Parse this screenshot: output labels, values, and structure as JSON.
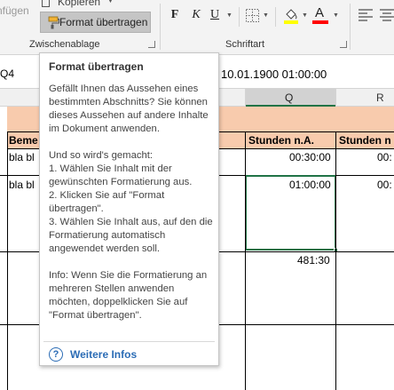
{
  "ribbon": {
    "paste_partial": "nfügen",
    "copy_label": "Kopieren",
    "format_painter_label": "Format übertragen",
    "clipboard_group": "Zwischenablage",
    "font_group": "Schriftart",
    "bold": "F",
    "italic": "K",
    "underline": "U"
  },
  "formula_bar": {
    "name_box_partial": "Q4",
    "value": "10.01.1900  01:00:00"
  },
  "columns": {
    "q": "Q",
    "r": "R"
  },
  "rows": {
    "header_left": "Beme",
    "header_q": "Stunden n.A.",
    "header_r": "Stunden n",
    "row1_left": "bla bl",
    "row1_q": "00:30:00",
    "row1_r": "00:",
    "row2_left": "bla bl",
    "row2_q": "01:00:00",
    "row2_r": "00:",
    "total_q": "481:30"
  },
  "tooltip": {
    "title": "Format übertragen",
    "p1": "Gefällt Ihnen das Aussehen eines bestimmten Abschnitts? Sie können dieses Aussehen auf andere Inhalte im Dokument anwenden.",
    "p2_heading": "Und so wird's gemacht:",
    "step1": "1. Wählen Sie Inhalt mit der gewünschten Formatierung aus.",
    "step2": "2. Klicken Sie auf \"Format übertragen\".",
    "step3": "3. Wählen Sie Inhalt aus, auf den die Formatierung automatisch angewendet werden soll.",
    "info": "Info: Wenn Sie die Formatierung an mehreren Stellen anwenden möchten, doppelklicken Sie auf \"Format übertragen\".",
    "more_label": "Weitere Infos"
  },
  "colors": {
    "header_fill": "#f8cbad",
    "banner_fill": "#f8cbad",
    "selection_green": "#217346",
    "highlight_yellow": "#ffff00",
    "font_red": "#ff0000",
    "link_blue": "#2b6cb5"
  },
  "icons": [
    "format-painter-icon",
    "copy-icon",
    "border-icon",
    "fill-color-icon",
    "font-color-icon",
    "align-left-icon",
    "align-center-icon",
    "help-icon"
  ]
}
